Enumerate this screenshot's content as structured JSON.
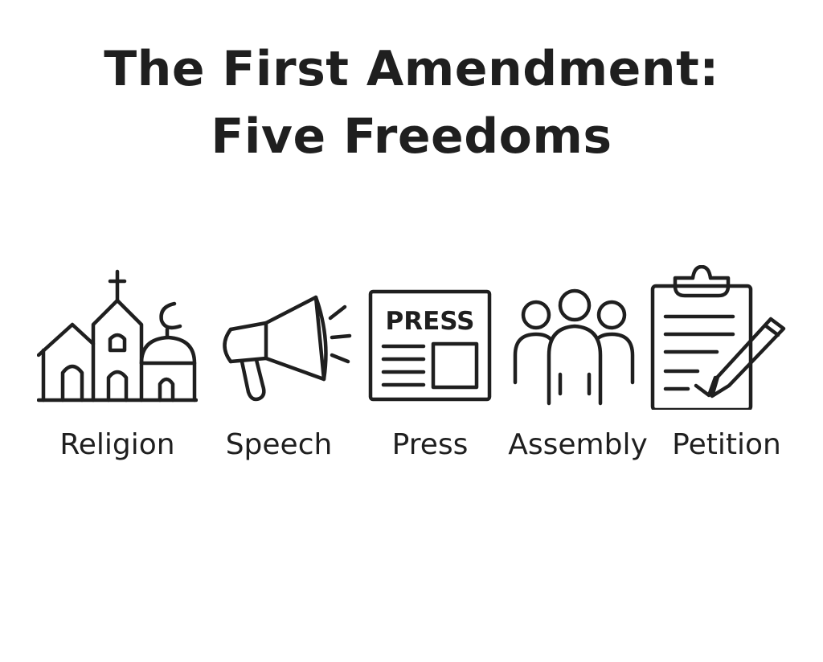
{
  "title": {
    "line1": "The First Amendment:",
    "line2": "Five Freedoms"
  },
  "freedoms": [
    {
      "label": "Religion",
      "icon": "houses-of-worship-icon"
    },
    {
      "label": "Speech",
      "icon": "megaphone-icon"
    },
    {
      "label": "Press",
      "icon": "newspaper-icon",
      "icon_text": "PRESS"
    },
    {
      "label": "Assembly",
      "icon": "group-of-people-icon"
    },
    {
      "label": "Petition",
      "icon": "clipboard-pencil-icon"
    }
  ]
}
